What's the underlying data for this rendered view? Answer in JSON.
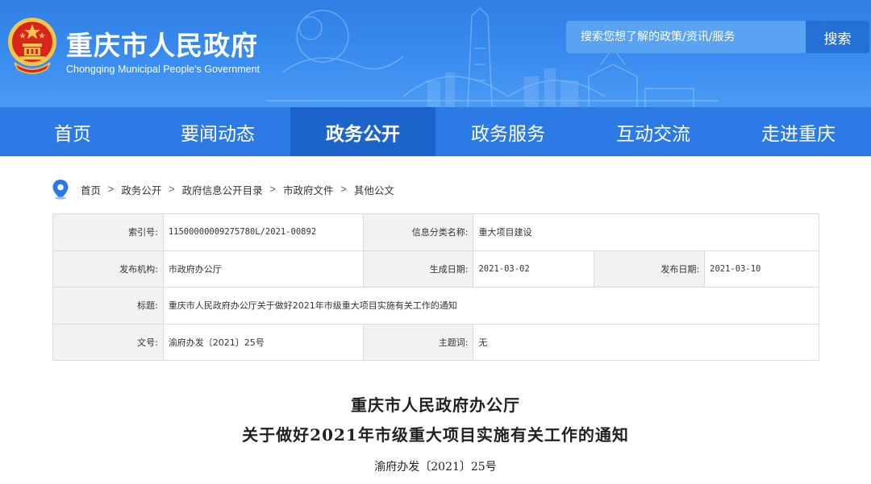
{
  "header": {
    "site_title": "重庆市人民政府",
    "site_subtitle": "Chongqing Municipal People's Government",
    "search_placeholder": "搜索您想了解的政策/资讯/服务",
    "search_button": "搜索",
    "emblem_icon": "national-emblem-icon",
    "colors": {
      "banner": "#3a8cf0",
      "nav": "#2b7ae6",
      "nav_active": "#1c63cc"
    }
  },
  "nav": {
    "items": [
      {
        "label": "首页"
      },
      {
        "label": "要闻动态"
      },
      {
        "label": "政务公开",
        "active": true
      },
      {
        "label": "政务服务"
      },
      {
        "label": "互动交流"
      },
      {
        "label": "走进重庆"
      }
    ]
  },
  "breadcrumb": {
    "icon": "location-pin-icon",
    "separator": ">",
    "items": [
      "首页",
      "政务公开",
      "政府信息公开目录",
      "市政府文件",
      "其他公文"
    ]
  },
  "info": {
    "index_label": "索引号:",
    "index_value": "11500000009275780L/2021-00892",
    "category_label": "信息分类名称:",
    "category_value": "重大项目建设",
    "publisher_label": "发布机构:",
    "publisher_value": "市政府办公厅",
    "generated_label": "生成日期:",
    "generated_value": "2021-03-02",
    "published_label": "发布日期:",
    "published_value": "2021-03-10",
    "title_label": "标题:",
    "title_value": "重庆市人民政府办公厅关于做好2021年市级重大项目实施有关工作的通知",
    "docno_label": "文号:",
    "docno_value": "渝府办发〔2021〕25号",
    "keyword_label": "主题词:",
    "keyword_value": "无"
  },
  "document": {
    "issuer": "重庆市人民政府办公厅",
    "title": "关于做好2021年市级重大项目实施有关工作的通知",
    "number": "渝府办发〔2021〕25号"
  }
}
